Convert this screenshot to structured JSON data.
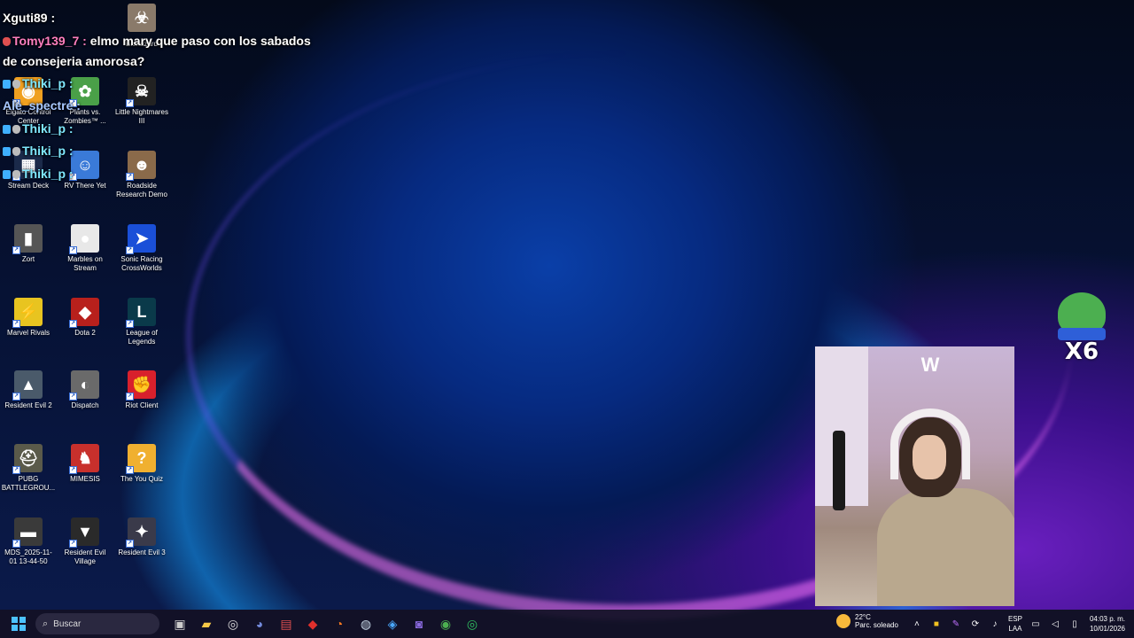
{
  "desktop": {
    "icons": [
      {
        "label": "Elgato Control Center",
        "glyph": "◉",
        "color": "#f0a020"
      },
      {
        "label": "Plants vs. Zombies™ ...",
        "glyph": "✿",
        "color": "#4aa048"
      },
      {
        "label": "Little Nightmares III",
        "glyph": "☠",
        "color": "#222222"
      },
      {
        "label": "Stream Deck",
        "glyph": "▦",
        "color": "#1b2a4a"
      },
      {
        "label": "RV There Yet",
        "glyph": "☺",
        "color": "#3a7ad8"
      },
      {
        "label": "Roadside Research Demo",
        "glyph": "☻",
        "color": "#8a6a4a"
      },
      {
        "label": "Zort",
        "glyph": "▮",
        "color": "#555555"
      },
      {
        "label": "Marbles on Stream",
        "glyph": "●",
        "color": "#e8e8e8"
      },
      {
        "label": "Sonic Racing CrossWorlds",
        "glyph": "➤",
        "color": "#1a4fd8"
      },
      {
        "label": "Marvel Rivals",
        "glyph": "⚡",
        "color": "#e8c420"
      },
      {
        "label": "Dota 2",
        "glyph": "◆",
        "color": "#b8201c"
      },
      {
        "label": "League of Legends",
        "glyph": "L",
        "color": "#0a3a4a"
      },
      {
        "label": "Resident Evil 2",
        "glyph": "▲",
        "color": "#4a5a6a"
      },
      {
        "label": "Dispatch",
        "glyph": "◐",
        "color": "#6a6a6a"
      },
      {
        "label": "Riot Client",
        "glyph": "✊",
        "color": "#d8202c"
      },
      {
        "label": "PUBG BATTLEGROU...",
        "glyph": "⛑",
        "color": "#5a5a4a"
      },
      {
        "label": "MIMESIS",
        "glyph": "♞",
        "color": "#c8302c"
      },
      {
        "label": "The You Quiz",
        "glyph": "?",
        "color": "#f0b030"
      },
      {
        "label": "MDS_2025-11-01 13-44-50",
        "glyph": "▬",
        "color": "#3a3a3a"
      },
      {
        "label": "Resident Evil Village",
        "glyph": "▼",
        "color": "#2a2a2a"
      },
      {
        "label": "Resident Evil 3",
        "glyph": "✦",
        "color": "#3a3a4a"
      }
    ],
    "top_partial_icons": [
      {
        "label": "Biohazard"
      }
    ]
  },
  "chat": {
    "messages": [
      {
        "user": "Xguti89 :",
        "text": "",
        "user_color": "#ffffff",
        "badges": []
      },
      {
        "user": "Tomy139_7 :",
        "text": "elmo mary que paso con los sabados",
        "user_color": "#ff7fbf",
        "badges": [
          "red"
        ]
      },
      {
        "user": "",
        "text": "de consejeria amorosa?",
        "user_color": "#ffffff",
        "badges": []
      },
      {
        "user": "Thiki_p :",
        "text": "",
        "user_color": "#7fe8ff",
        "badges": [
          "cube",
          "shield"
        ]
      },
      {
        "user": "Ale_spectre :",
        "text": "",
        "user_color": "#a8c8ff",
        "badges": []
      },
      {
        "user": "Thiki_p :",
        "text": "",
        "user_color": "#7fe8ff",
        "badges": [
          "cube",
          "shield"
        ]
      },
      {
        "user": "Thiki_p :",
        "text": "",
        "user_color": "#7fe8ff",
        "badges": [
          "cube",
          "shield"
        ]
      },
      {
        "user": "Thiki_p :",
        "text": "",
        "user_color": "#7fe8ff",
        "badges": [
          "cube",
          "shield"
        ]
      }
    ]
  },
  "emote_combo": {
    "count": "X6"
  },
  "taskbar": {
    "search_placeholder": "Buscar",
    "weather_temp": "22°C",
    "weather_desc": "Parc. soleado",
    "weather_badge": "1",
    "lang_top": "ESP",
    "lang_bottom": "LAA",
    "time": "04:03 p. m.",
    "date": "10/01/2026",
    "apps": [
      "task-view",
      "file-explorer",
      "obs",
      "discord",
      "voicemeeter",
      "app-red",
      "firefox",
      "steam",
      "app-blue",
      "app-purple",
      "chrome",
      "app-green"
    ]
  }
}
